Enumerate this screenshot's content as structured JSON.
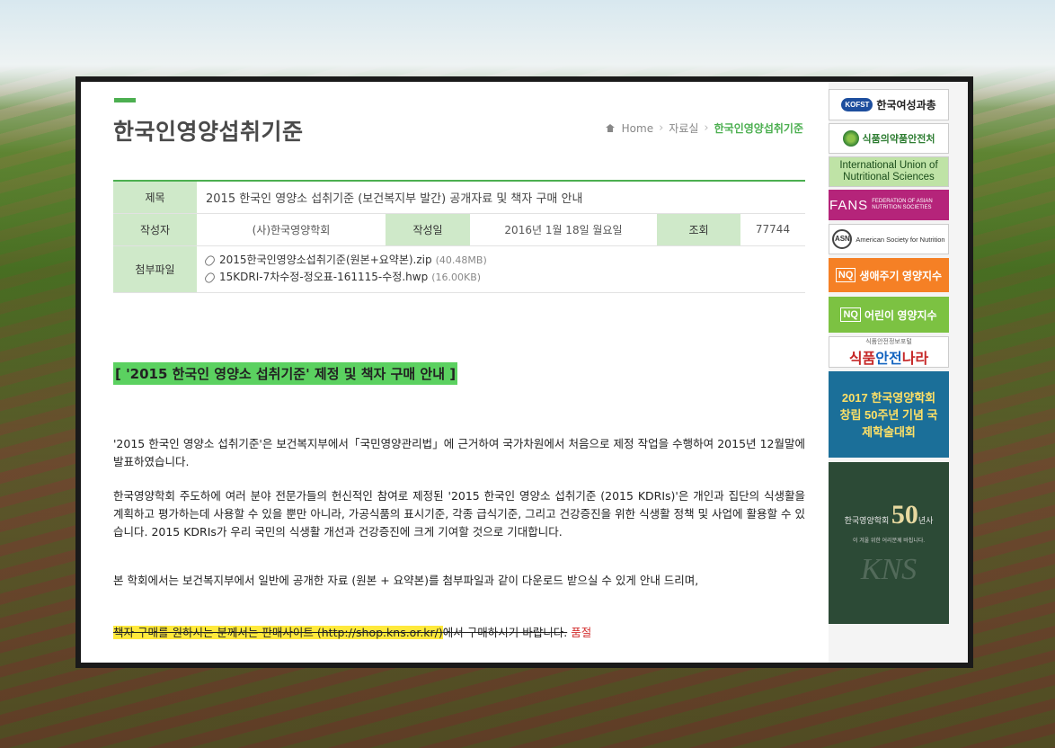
{
  "page": {
    "title": "한국인영양섭취기준"
  },
  "breadcrumb": {
    "home": "Home",
    "section": "자료실",
    "current": "한국인영양섭취기준"
  },
  "post": {
    "subject_label": "제목",
    "subject": "2015 한국인 영양소 섭취기준 (보건복지부 발간) 공개자료 및 책자 구매 안내",
    "author_label": "작성자",
    "author": "(사)한국영양학회",
    "date_label": "작성일",
    "date": "2016년 1월 18일 월요일",
    "views_label": "조회",
    "views": "77744",
    "attach_label": "첨부파일",
    "attachments": [
      {
        "name": "2015한국인영양소섭취기준(원본+요약본).zip",
        "size": "(40.48MB)"
      },
      {
        "name": "15KDRI-7차수정-정오표-161115-수정.hwp",
        "size": "(16.00KB)"
      }
    ]
  },
  "content": {
    "heading": "[ '2015 한국인 영양소 섭취기준' 제정 및 책자 구매 안내 ]",
    "p1": "'2015 한국인 영양소 섭취기준'은 보건복지부에서「국민영양관리법」에 근거하여 국가차원에서 처음으로 제정 작업을 수행하여 2015년 12월말에 발표하였습니다.",
    "p2": "한국영양학회 주도하에 여러 분야 전문가들의 헌신적인 참여로 제정된 '2015 한국인 영양소 섭취기준 (2015 KDRIs)'은 개인과 집단의 식생활을 계획하고 평가하는데 사용할 수 있을 뿐만 아니라, 가공식품의 표시기준, 각종 급식기준, 그리고 건강증진을 위한 식생활 정책 및 사업에 활용할 수 있습니다. 2015 KDRIs가 우리 국민의 식생활 개선과 건강증진에 크게 기여할 것으로 기대합니다.",
    "p3": "본 학회에서는 보건복지부에서 일반에 공개한 자료 (원본 + 요약본)를 첨부파일과 같이 다운로드 받으실 수 있게 안내 드리며,",
    "p4_highlight": "책자 구매를 원하시는 분께서는 판매사이트 (http://shop.kns.or.kr/)",
    "p4_rest": "에서 구매하시기 바랍니다.",
    "p4_soldout": "품절"
  },
  "sidebar": {
    "kofst_logo": "KOFST",
    "kofst": "한국여성과총",
    "mfds": "식품의약품안전처",
    "iuns": "International Union of Nutritional Sciences",
    "fans": "FANS",
    "fans_sub": "FEDERATION OF ASIAN NUTRITION SOCIETIES",
    "asn_logo": "ASN",
    "asn": "American Society for Nutrition",
    "nq1_tag": "NQ",
    "nq1": "생애주기 영양지수",
    "nq2_tag": "NQ",
    "nq2": "어린이 영양지수",
    "food_sub": "식품안전정보포털",
    "food_a": "식품",
    "food_b": "안전",
    "food_c": "나라",
    "event": "2017 한국영양학회 창립 50주년 기념 국제학술대회",
    "fifty_title": "한국영양학회",
    "fifty_num": "50",
    "fifty_suffix": "년사",
    "fifty_sub": "이 겨울 위한 어리분께 바칩니다.",
    "fifty_kns": "KNS"
  }
}
